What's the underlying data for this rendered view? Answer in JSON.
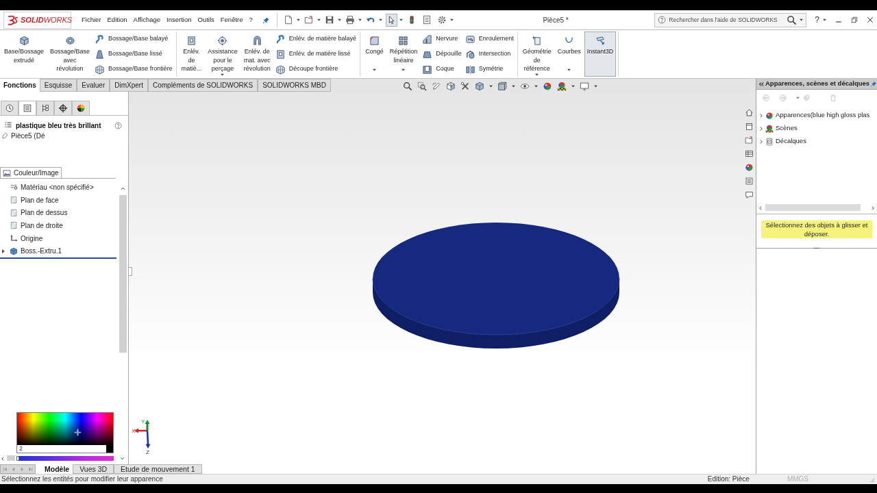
{
  "title_bar": {
    "brand": "**SOLID**WORKS",
    "menu": [
      "Fichier",
      "Edition",
      "Affichage",
      "Insertion",
      "Outils",
      "Fenêtre",
      "?"
    ],
    "quick_toolbar": [
      {
        "dropdown": true,
        "selected": false
      },
      {
        "dropdown": true,
        "selected": false
      },
      {
        "dropdown": true,
        "selected": false
      },
      {
        "dropdown": true,
        "selected": false
      },
      {
        "dropdown": true,
        "selected": false
      },
      {
        "dropdown": true,
        "selected": true
      },
      {
        "dropdown": false,
        "selected": false
      },
      {
        "dropdown": false,
        "selected": false
      },
      {
        "dropdown": true,
        "selected": false
      }
    ],
    "document_title": "Pièce5 *",
    "search": {
      "placeholder": "Rechercher dans l'aide de SOLIDWORKS"
    },
    "help": "?"
  },
  "ribbon": {
    "groups": [
      {
        "columns": [
          {
            "kind": "large",
            "label": "Base/Bossage\nextrudé",
            "dropdown": false,
            "on": false
          },
          {
            "kind": "large",
            "label": "Bossage/Base\navec\nrévolution",
            "dropdown": false,
            "on": false
          },
          {
            "kind": "stack",
            "entries": [
              "Bossage/Base balayé",
              "Bossage/Base lissé",
              "Bossage/Base frontière"
            ]
          }
        ]
      },
      {
        "columns": [
          {
            "kind": "large",
            "label": "Enlév.\nde\nmatiè...",
            "dropdown": false,
            "on": false
          },
          {
            "kind": "large",
            "label": "Assistance\npour le\nperçage",
            "dropdown": true,
            "on": false
          },
          {
            "kind": "large",
            "label": "Enlév. de\nmat. avec\nrévolution",
            "dropdown": false,
            "on": false
          },
          {
            "kind": "stack",
            "entries": [
              "Enlév. de matière balayé",
              "Enlév. de matière lissé",
              "Découpe frontière"
            ]
          }
        ]
      },
      {
        "columns": [
          {
            "kind": "large",
            "label": "Congé",
            "dropdown": true,
            "on": false
          },
          {
            "kind": "large",
            "label": "Répétition\nlinéaire",
            "dropdown": true,
            "on": false
          },
          {
            "kind": "stack",
            "entries": [
              "Nervure",
              "Dépouille",
              "Coque"
            ]
          },
          {
            "kind": "stack",
            "entries": [
              "Enroulement",
              "Intersection",
              "Symétrie"
            ]
          }
        ]
      },
      {
        "columns": [
          {
            "kind": "large",
            "label": "Géométrie\nde\nréférence",
            "dropdown": true,
            "on": false
          },
          {
            "kind": "large",
            "label": "Courbes",
            "dropdown": true,
            "on": false
          },
          {
            "kind": "large",
            "label": "Instant3D",
            "dropdown": false,
            "on": true
          }
        ]
      }
    ]
  },
  "command_tabs": [
    {
      "label": "Fonctions",
      "selected": true
    },
    {
      "label": "Esquisse",
      "selected": false
    },
    {
      "label": "Evaluer",
      "selected": false
    },
    {
      "label": "DimXpert",
      "selected": false
    },
    {
      "label": "Compléments de SOLIDWORKS",
      "selected": false
    },
    {
      "label": "SOLIDWORKS MBD",
      "selected": false
    }
  ],
  "feature_manager": {
    "tabs": [
      {
        "selected": false
      },
      {
        "selected": true
      },
      {
        "selected": false
      },
      {
        "selected": false
      },
      {
        "selected": false
      }
    ],
    "title": "plastique bleu très brillant",
    "part": "Pièce5 (Dé",
    "section_tab": "Couleur/Image",
    "tree": [
      {
        "kind": "material",
        "label": "Matériau <non spécifié>"
      },
      {
        "kind": "plane",
        "label": "Plan de face"
      },
      {
        "kind": "plane",
        "label": "Plan de dessus"
      },
      {
        "kind": "plane",
        "label": "Plan de droite"
      },
      {
        "kind": "origin",
        "label": "Origine"
      },
      {
        "kind": "feature",
        "label": "Boss.-Extru.1",
        "expanded": false
      }
    ],
    "color_picker": {
      "value": "2",
      "hue": {
        "level": 0
      }
    }
  },
  "graphics": {
    "triad": {
      "x": "X",
      "y": "Y",
      "z": "Z"
    }
  },
  "task_pane": {
    "title": "Apparences, scènes et décalques",
    "tree": [
      {
        "kind": "appearances",
        "label": "Apparences(blue high gloss plas"
      },
      {
        "kind": "scenes",
        "label": "Scènes"
      },
      {
        "kind": "decals",
        "label": "Décalques"
      }
    ],
    "hint": "Sélectionnez des objets à glisser et déposer."
  },
  "bottom_tabs": [
    {
      "label": "Modèle",
      "selected": true
    },
    {
      "label": "Vues 3D",
      "selected": false
    },
    {
      "label": "Etude de mouvement 1",
      "selected": false
    }
  ],
  "status_bar": {
    "message": "Sélectionnez les entités pour modifier leur apparence",
    "mode": "Edition: Pièce",
    "units": "MMGS"
  }
}
